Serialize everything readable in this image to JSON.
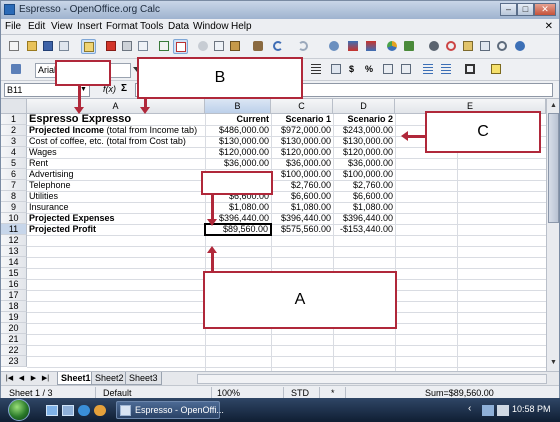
{
  "window": {
    "title": "Espresso - OpenOffice.org Calc",
    "min_glyph": "–",
    "max_glyph": "□",
    "close_glyph": "✕"
  },
  "menu": [
    "File",
    "Edit",
    "View",
    "Insert",
    "Format",
    "Tools",
    "Data",
    "Window",
    "Help"
  ],
  "menu_close": "✕",
  "formatting": {
    "font_name": "Arial",
    "percent": "%",
    "currency": "$"
  },
  "formula_bar": {
    "cell_ref": "B11",
    "fx": "f(x)",
    "sigma": "Σ",
    "formula": ""
  },
  "columns": [
    "A",
    "B",
    "C",
    "D",
    "E"
  ],
  "rows": [
    "1",
    "2",
    "3",
    "4",
    "5",
    "6",
    "7",
    "8",
    "9",
    "10",
    "11",
    "12",
    "13",
    "14",
    "15",
    "16",
    "17",
    "18",
    "19",
    "20",
    "21",
    "22",
    "23"
  ],
  "sheet": {
    "r1": {
      "a": "Espresso Expresso",
      "b": "Current",
      "c": "Scenario 1",
      "d": "Scenario 2"
    },
    "r2": {
      "a_bold": "Projected Income",
      "a_note": " (total from Income tab)",
      "b": "$486,000.00",
      "c": "$972,000.00",
      "d": "$243,000.00"
    },
    "r3": {
      "a": "Cost of coffee, etc.  (total from Cost tab)",
      "b": "$130,000.00",
      "c": "$130,000.00",
      "d": "$130,000.00"
    },
    "r4": {
      "a": "Wages",
      "b": "$120,000.00",
      "c": "$120,000.00",
      "d": "$120,000.00"
    },
    "r5": {
      "a": "Rent",
      "b": "$36,000.00",
      "c": "$36,000.00",
      "d": "$36,000.00"
    },
    "r6": {
      "a": "Advertising",
      "b": "",
      "c": "$100,000.00",
      "d": "$100,000.00"
    },
    "r7": {
      "a": "Telephone",
      "b": "",
      "c": "$2,760.00",
      "d": "$2,760.00"
    },
    "r8": {
      "a": "Utilities",
      "b": "$6,600.00",
      "c": "$6,600.00",
      "d": "$6,600.00"
    },
    "r9": {
      "a": "Insurance",
      "b": "$1,080.00",
      "c": "$1,080.00",
      "d": "$1,080.00"
    },
    "r10": {
      "a": "Projected Expenses",
      "b": "$396,440.00",
      "c": "$396,440.00",
      "d": "$396,440.00"
    },
    "r11": {
      "a": "Projected Profit",
      "b": "$89,560.00",
      "c": "$575,560.00",
      "d": "-$153,440.00"
    }
  },
  "callouts": {
    "a": "A",
    "b": "B",
    "c": "C"
  },
  "sheet_tabs": [
    "Sheet1",
    "Sheet2",
    "Sheet3"
  ],
  "status": {
    "sheet": "Sheet 1 / 3",
    "style": "Default",
    "zoom": "100%",
    "mode": "STD",
    "star": "*",
    "sum": "Sum=$89,560.00"
  },
  "taskbar": {
    "task": "Espresso - OpenOffi...",
    "clock": "10:58 PM"
  },
  "colors": {
    "callout_border": "#b0283a",
    "title_bar": "#9fb3cf",
    "taskbar": "#1b2b44"
  }
}
